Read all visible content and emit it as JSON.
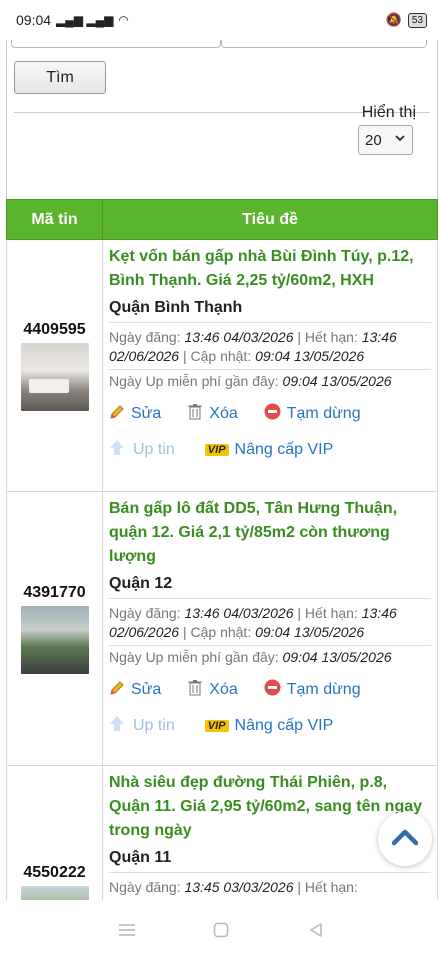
{
  "status": {
    "time": "09:04",
    "battery": "53"
  },
  "search": {
    "button_label": "Tìm",
    "show_label": "Hiển thị",
    "show_value": "20"
  },
  "table": {
    "headers": [
      "Mã tin",
      "Tiêu đề"
    ],
    "rows": [
      {
        "id": "4409595",
        "title": "Kẹt vốn bán gấp nhà Bùi Đình Túy, p.12, Bình Thạnh. Giá 2,25 tỷ/60m2, HXH",
        "district": "Quận Bình Thạnh",
        "posted_label": "Ngày đăng:",
        "posted": "13:46 04/03/2026",
        "expire_label": "| Hết hạn:",
        "expire": "13:46 02/06/2026",
        "updated_label": "| Cập nhật:",
        "updated": "09:04 13/05/2026",
        "free_up_label": "Ngày Up miễn phí gần đây:",
        "free_up": "09:04 13/05/2026"
      },
      {
        "id": "4391770",
        "title": "Bán gấp lô đất DD5, Tân Hưng Thuận, quận 12. Giá 2,1 tỷ/85m2 còn thương lượng",
        "district": "Quận 12",
        "posted_label": "Ngày đăng:",
        "posted": "13:46 04/03/2026",
        "expire_label": "| Hết hạn:",
        "expire": "13:46 02/06/2026",
        "updated_label": "| Cập nhật:",
        "updated": "09:04 13/05/2026",
        "free_up_label": "Ngày Up miễn phí gần đây:",
        "free_up": "09:04 13/05/2026"
      },
      {
        "id": "4550222",
        "title": "Nhà siêu đẹp đường Thái Phiên, p.8, Quận 11. Giá 2,95 tỷ/60m2, sang tên ngay trong ngày",
        "district": "Quận 11",
        "posted_label": "Ngày đăng:",
        "posted": "13:45 03/03/2026",
        "expire_label": "| Hết hạn:"
      }
    ]
  },
  "actions": {
    "edit": "Sửa",
    "delete": "Xóa",
    "pause": "Tạm dừng",
    "up": "Up tin",
    "vip_badge": "VIP",
    "vip": "Nâng cấp VIP"
  },
  "colors": {
    "header_green": "#5ab42d",
    "title_green": "#3b8c22",
    "link_blue": "#2a72c5"
  }
}
